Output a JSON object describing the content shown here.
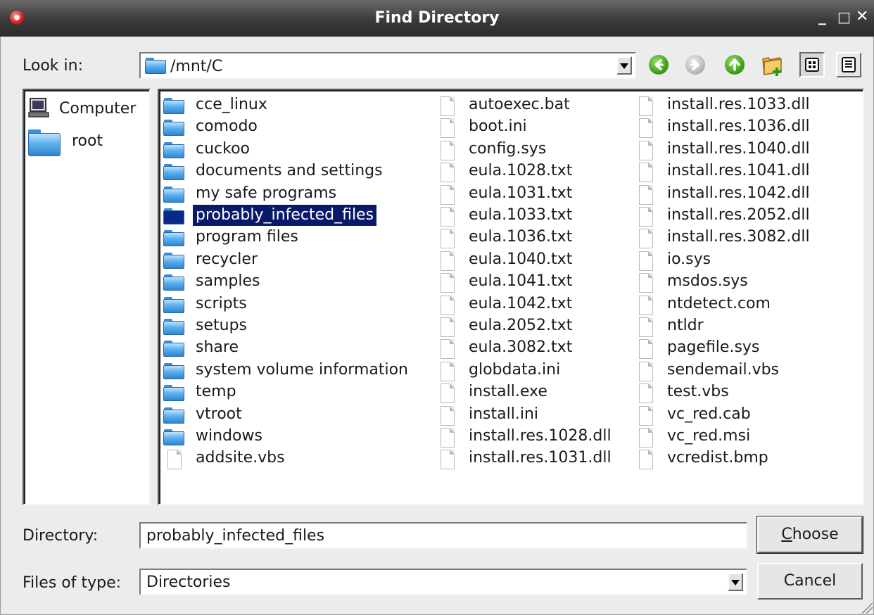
{
  "window": {
    "title": "Find Directory",
    "minimize_glyph": "_",
    "maximize_glyph": "□",
    "close_glyph": "✕"
  },
  "look_in": {
    "label": "Look in:",
    "value": "/mnt/C"
  },
  "toolbar": {
    "icons": [
      "back-icon",
      "forward-icon",
      "up-folder-icon",
      "new-folder-icon",
      "list-view-icon",
      "details-view-icon"
    ]
  },
  "sidebar": {
    "items": [
      {
        "label": "Computer",
        "icon": "computer-icon"
      },
      {
        "label": "root",
        "icon": "folder-icon"
      }
    ]
  },
  "files": {
    "selected": "probably_infected_files",
    "columns": [
      [
        {
          "name": "cce_linux",
          "type": "folder"
        },
        {
          "name": "comodo",
          "type": "folder"
        },
        {
          "name": "cuckoo",
          "type": "folder"
        },
        {
          "name": "documents and settings",
          "type": "folder"
        },
        {
          "name": "my safe programs",
          "type": "folder"
        },
        {
          "name": "probably_infected_files",
          "type": "folder"
        },
        {
          "name": "program files",
          "type": "folder"
        },
        {
          "name": "recycler",
          "type": "folder"
        },
        {
          "name": "samples",
          "type": "folder"
        },
        {
          "name": "scripts",
          "type": "folder"
        },
        {
          "name": "setups",
          "type": "folder"
        },
        {
          "name": "share",
          "type": "folder"
        },
        {
          "name": "system volume information",
          "type": "folder"
        },
        {
          "name": "temp",
          "type": "folder"
        },
        {
          "name": "vtroot",
          "type": "folder"
        },
        {
          "name": "windows",
          "type": "folder"
        },
        {
          "name": "addsite.vbs",
          "type": "file"
        }
      ],
      [
        {
          "name": "autoexec.bat",
          "type": "file"
        },
        {
          "name": "boot.ini",
          "type": "file"
        },
        {
          "name": "config.sys",
          "type": "file"
        },
        {
          "name": "eula.1028.txt",
          "type": "file"
        },
        {
          "name": "eula.1031.txt",
          "type": "file"
        },
        {
          "name": "eula.1033.txt",
          "type": "file"
        },
        {
          "name": "eula.1036.txt",
          "type": "file"
        },
        {
          "name": "eula.1040.txt",
          "type": "file"
        },
        {
          "name": "eula.1041.txt",
          "type": "file"
        },
        {
          "name": "eula.1042.txt",
          "type": "file"
        },
        {
          "name": "eula.2052.txt",
          "type": "file"
        },
        {
          "name": "eula.3082.txt",
          "type": "file"
        },
        {
          "name": "globdata.ini",
          "type": "file"
        },
        {
          "name": "install.exe",
          "type": "file"
        },
        {
          "name": "install.ini",
          "type": "file"
        },
        {
          "name": "install.res.1028.dll",
          "type": "file"
        },
        {
          "name": "install.res.1031.dll",
          "type": "file"
        }
      ],
      [
        {
          "name": "install.res.1033.dll",
          "type": "file"
        },
        {
          "name": "install.res.1036.dll",
          "type": "file"
        },
        {
          "name": "install.res.1040.dll",
          "type": "file"
        },
        {
          "name": "install.res.1041.dll",
          "type": "file"
        },
        {
          "name": "install.res.1042.dll",
          "type": "file"
        },
        {
          "name": "install.res.2052.dll",
          "type": "file"
        },
        {
          "name": "install.res.3082.dll",
          "type": "file"
        },
        {
          "name": "io.sys",
          "type": "file"
        },
        {
          "name": "msdos.sys",
          "type": "file"
        },
        {
          "name": "ntdetect.com",
          "type": "file"
        },
        {
          "name": "ntldr",
          "type": "file"
        },
        {
          "name": "pagefile.sys",
          "type": "file"
        },
        {
          "name": "sendemail.vbs",
          "type": "file"
        },
        {
          "name": "test.vbs",
          "type": "file"
        },
        {
          "name": "vc_red.cab",
          "type": "file"
        },
        {
          "name": "vc_red.msi",
          "type": "file"
        },
        {
          "name": "vcredist.bmp",
          "type": "file"
        }
      ]
    ]
  },
  "directory": {
    "label": "Directory:",
    "value": "probably_infected_files"
  },
  "file_type": {
    "label": "Files of type:",
    "value": "Directories"
  },
  "buttons": {
    "choose": "Choose",
    "cancel": "Cancel"
  },
  "colors": {
    "selection": "#0a1a6b",
    "titlebar": "#3a3a3a",
    "dialog_bg": "#ececec",
    "folder": "#5fb0ee"
  }
}
